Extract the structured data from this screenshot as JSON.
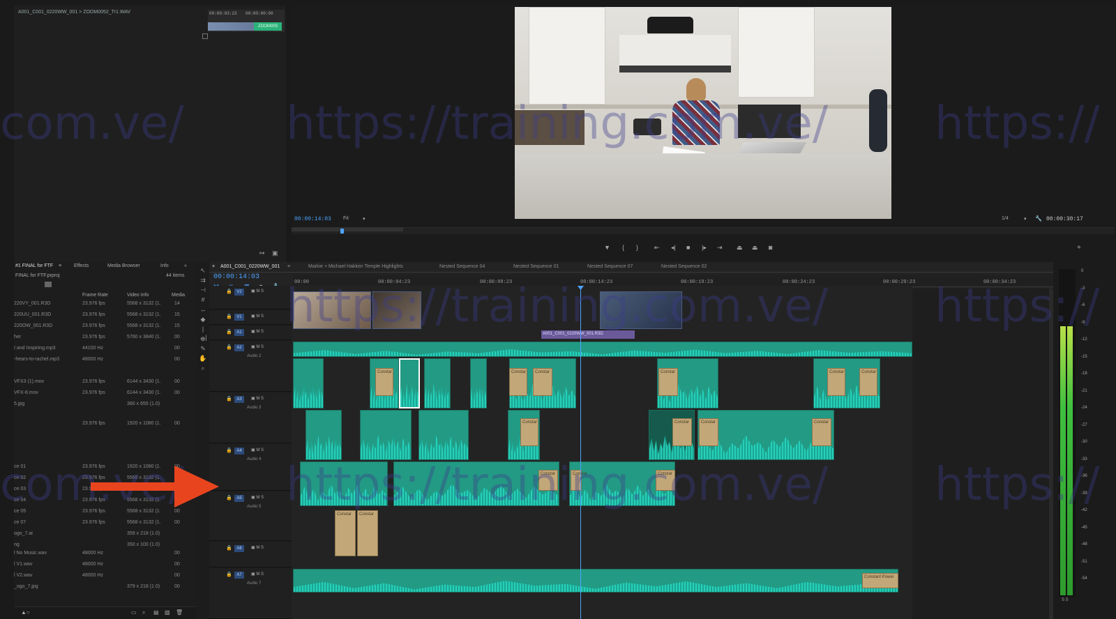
{
  "source": {
    "clip_title": "A001_C001_0220WW_001 > ZOOM0052_Tr1.WAV",
    "tc_in": "00:00:03:23",
    "tc_out": "00:00:00:00",
    "clip_label": "ZOOM003"
  },
  "program": {
    "timecode": "00:00:14:03",
    "fit": "Fit",
    "resolution": "1/4",
    "duration": "00:00:30:17"
  },
  "project": {
    "tabs": [
      "#1 FINAL for FTF",
      "Effects",
      "Media Browser",
      "Info"
    ],
    "path": "FINAL for FTF.prproj",
    "item_count": "44 items",
    "columns": [
      "Frame Rate",
      "Video Info",
      "Media"
    ],
    "rows": [
      {
        "name": "220VY_001.R3D",
        "rate": "23.976 fps",
        "info": "5568 x 3132 (1.",
        "media": "14"
      },
      {
        "name": "220UU_001.R3D",
        "rate": "23.976 fps",
        "info": "5568 x 3132 (1.",
        "media": "15"
      },
      {
        "name": "220OW_001.R3D",
        "rate": "23.976 fps",
        "info": "5568 x 3132 (1.",
        "media": "15"
      },
      {
        "name": "her",
        "rate": "23.976 fps",
        "info": "5760 x 3840 (1.",
        "media": "00"
      },
      {
        "name": "I and Inspiring.mp3",
        "rate": "44100 Hz",
        "info": "",
        "media": "00"
      },
      {
        "name": "-hears-to-rachel.mp3",
        "rate": "48000 Hz",
        "info": "",
        "media": "00"
      },
      {
        "name": "VFX3 (1).mov",
        "rate": "23.976 fps",
        "info": "6144 x 3430 (1.",
        "media": "00"
      },
      {
        "name": "VFX-8.mov",
        "rate": "23.976 fps",
        "info": "6144 x 3430 (1.",
        "media": "00"
      },
      {
        "name": "5.jpg",
        "rate": "",
        "info": "360 x 655 (1.0)",
        "media": ""
      },
      {
        "name": "",
        "rate": "23.976 fps",
        "info": "1920 x 1080 (1.",
        "media": "00"
      },
      {
        "name": "ce 01",
        "rate": "23.976 fps",
        "info": "1920 x 1080 (1.",
        "media": "00"
      },
      {
        "name": "ce 02",
        "rate": "23.976 fps",
        "info": "5568 x 3132 (1.",
        "media": "00"
      },
      {
        "name": "ce 03",
        "rate": "23.976 fps",
        "info": "5568 x 3132 (1.",
        "media": "00"
      },
      {
        "name": "ce 04",
        "rate": "23.976 fps",
        "info": "5568 x 3132 (1.",
        "media": "00"
      },
      {
        "name": "ce 05",
        "rate": "23.976 fps",
        "info": "5568 x 3132 (1.",
        "media": "00"
      },
      {
        "name": "ce 07",
        "rate": "23.976 fps",
        "info": "5568 x 3132 (1.",
        "media": "00"
      },
      {
        "name": "ogo_7.ai",
        "rate": "",
        "info": "359 x 218 (1.0)",
        "media": ""
      },
      {
        "name": "ng",
        "rate": "",
        "info": "350 x 100 (1.0)",
        "media": ""
      },
      {
        "name": "l No Music.wav",
        "rate": "48000 Hz",
        "info": "",
        "media": "00"
      },
      {
        "name": "l V1.wav",
        "rate": "48000 Hz",
        "info": "",
        "media": "00"
      },
      {
        "name": "l V2.wav",
        "rate": "48000 Hz",
        "info": "",
        "media": "00"
      },
      {
        "name": "_ogo_7.jpg",
        "rate": "",
        "info": "379 x 218 (1.0)",
        "media": "00"
      }
    ]
  },
  "timeline": {
    "active_tab": "A001_C001_0220WW_001",
    "tabs": [
      "Markie + Michael Hakken Temple Highlights",
      "Nested Sequence 04",
      "Nested Sequence 01",
      "Nested Sequence 07",
      "Nested Sequence 02"
    ],
    "timecode": "00:00:14:03",
    "ruler": [
      "00:00",
      "00:00:04:23",
      "00:00:09:23",
      "00:00:14:23",
      "00:00:19:23",
      "00:00:24:23",
      "00:00:29:23",
      "00:00:34:23"
    ],
    "video_label": "A001_C001_0220WW_001.R3D",
    "tracks": [
      {
        "id": "V2",
        "name": ""
      },
      {
        "id": "V1",
        "name": ""
      },
      {
        "id": "A1",
        "name": ""
      },
      {
        "id": "A2",
        "name": "Audio 2"
      },
      {
        "id": "A3",
        "name": "Audio 3"
      },
      {
        "id": "A4",
        "name": "Audio 4"
      },
      {
        "id": "A5",
        "name": "Audio 5"
      },
      {
        "id": "A6",
        "name": ""
      },
      {
        "id": "A7",
        "name": "Audio 7"
      }
    ],
    "nested_label": "Constar",
    "end_label": "Constant Power"
  },
  "meter": {
    "scale": [
      "0",
      "-3",
      "-6",
      "-9",
      "-12",
      "-15",
      "-18",
      "-21",
      "-24",
      "-27",
      "-30",
      "-33",
      "-36",
      "-39",
      "-42",
      "-45",
      "-48",
      "-51",
      "-54"
    ],
    "bottom": "S S"
  },
  "watermark": {
    "text_full": "https://training.com.ve/",
    "text_left": "com.ve/",
    "text_right": "https://"
  },
  "colors": {
    "accent": "#4da3ff",
    "audio_clip": "#239a84",
    "waveform": "#27d6c0",
    "nested_clip": "#c2a778",
    "arrow": "#e8451f"
  }
}
